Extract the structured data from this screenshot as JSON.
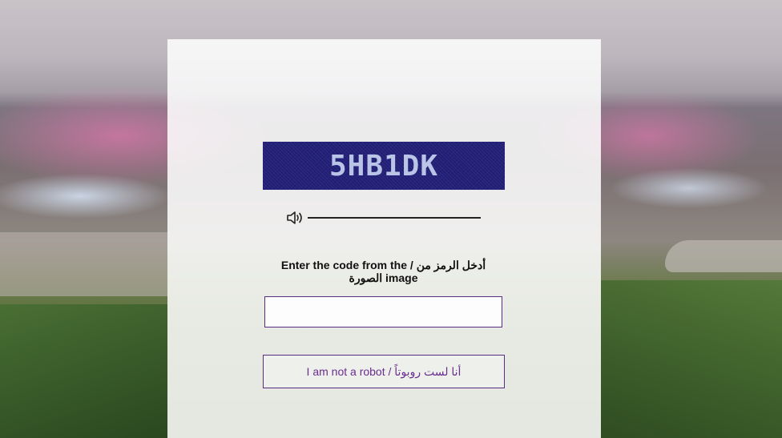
{
  "captcha": {
    "code": "5HB1DK",
    "image_bg_color": "#23207a",
    "text_color": "#b9c4e6"
  },
  "audio": {
    "icon": "speaker-volume-icon"
  },
  "prompt": {
    "text": "Enter the code from the / أدخل الرمز من الصورة image"
  },
  "code_input": {
    "value": "",
    "placeholder": ""
  },
  "robot_button": {
    "label": "I am not a robot / أنا لست روبوتاً"
  },
  "colors": {
    "accent": "#5b2d82",
    "button_text": "#6a2e8f"
  }
}
